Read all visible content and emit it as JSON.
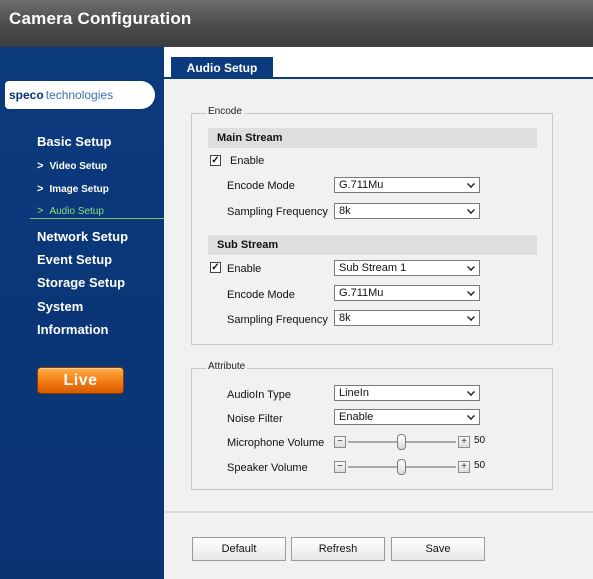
{
  "window": {
    "title": "Camera Configuration"
  },
  "logo": {
    "brand_bold": "speco",
    "brand_light": "technologies"
  },
  "sidebar": {
    "basic_setup": "Basic Setup",
    "sub_items": [
      {
        "label": "Video Setup",
        "active": false
      },
      {
        "label": "Image Setup",
        "active": false
      },
      {
        "label": "Audio Setup",
        "active": true
      }
    ],
    "network_setup": "Network Setup",
    "event_setup": "Event Setup",
    "storage_setup": "Storage Setup",
    "system": "System",
    "information": "Information",
    "live_button": "Live"
  },
  "tab": {
    "label": "Audio Setup"
  },
  "encode": {
    "legend": "Encode",
    "main_stream": {
      "header": "Main Stream",
      "enable_label": "Enable",
      "enable_checked": true,
      "encode_mode_label": "Encode Mode",
      "encode_mode_value": "G.711Mu",
      "sampling_label": "Sampling Frequency",
      "sampling_value": "8k"
    },
    "sub_stream": {
      "header": "Sub Stream",
      "enable_label": "Enable",
      "enable_checked": true,
      "stream_select_value": "Sub Stream 1",
      "encode_mode_label": "Encode Mode",
      "encode_mode_value": "G.711Mu",
      "sampling_label": "Sampling Frequency",
      "sampling_value": "8k"
    }
  },
  "attribute": {
    "legend": "Attribute",
    "audioin_type_label": "AudioIn Type",
    "audioin_type_value": "LineIn",
    "noise_filter_label": "Noise Filter",
    "noise_filter_value": "Enable",
    "mic_volume_label": "Microphone Volume",
    "mic_volume_value": "50",
    "speaker_volume_label": "Speaker Volume",
    "speaker_volume_value": "50",
    "minus_symbol": "−",
    "plus_symbol": "+"
  },
  "buttons": {
    "default": "Default",
    "refresh": "Refresh",
    "save": "Save"
  },
  "colors": {
    "sidebar": "#0b3a7d",
    "active_nav": "#8ee27a",
    "live": "#f47a12"
  }
}
